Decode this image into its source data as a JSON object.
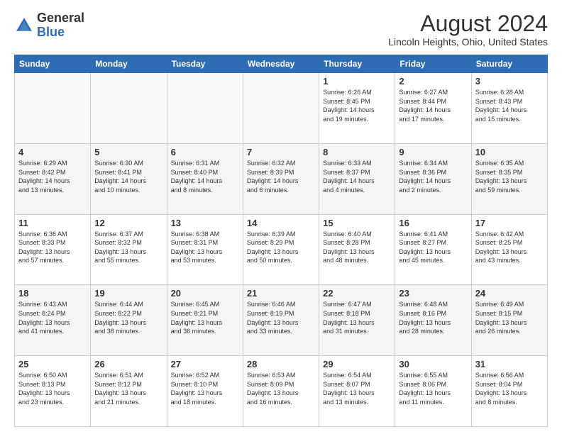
{
  "header": {
    "logo_general": "General",
    "logo_blue": "Blue",
    "title": "August 2024",
    "location": "Lincoln Heights, Ohio, United States"
  },
  "weekdays": [
    "Sunday",
    "Monday",
    "Tuesday",
    "Wednesday",
    "Thursday",
    "Friday",
    "Saturday"
  ],
  "weeks": [
    [
      {
        "day": "",
        "detail": ""
      },
      {
        "day": "",
        "detail": ""
      },
      {
        "day": "",
        "detail": ""
      },
      {
        "day": "",
        "detail": ""
      },
      {
        "day": "1",
        "detail": "Sunrise: 6:26 AM\nSunset: 8:45 PM\nDaylight: 14 hours\nand 19 minutes."
      },
      {
        "day": "2",
        "detail": "Sunrise: 6:27 AM\nSunset: 8:44 PM\nDaylight: 14 hours\nand 17 minutes."
      },
      {
        "day": "3",
        "detail": "Sunrise: 6:28 AM\nSunset: 8:43 PM\nDaylight: 14 hours\nand 15 minutes."
      }
    ],
    [
      {
        "day": "4",
        "detail": "Sunrise: 6:29 AM\nSunset: 8:42 PM\nDaylight: 14 hours\nand 13 minutes."
      },
      {
        "day": "5",
        "detail": "Sunrise: 6:30 AM\nSunset: 8:41 PM\nDaylight: 14 hours\nand 10 minutes."
      },
      {
        "day": "6",
        "detail": "Sunrise: 6:31 AM\nSunset: 8:40 PM\nDaylight: 14 hours\nand 8 minutes."
      },
      {
        "day": "7",
        "detail": "Sunrise: 6:32 AM\nSunset: 8:39 PM\nDaylight: 14 hours\nand 6 minutes."
      },
      {
        "day": "8",
        "detail": "Sunrise: 6:33 AM\nSunset: 8:37 PM\nDaylight: 14 hours\nand 4 minutes."
      },
      {
        "day": "9",
        "detail": "Sunrise: 6:34 AM\nSunset: 8:36 PM\nDaylight: 14 hours\nand 2 minutes."
      },
      {
        "day": "10",
        "detail": "Sunrise: 6:35 AM\nSunset: 8:35 PM\nDaylight: 13 hours\nand 59 minutes."
      }
    ],
    [
      {
        "day": "11",
        "detail": "Sunrise: 6:36 AM\nSunset: 8:33 PM\nDaylight: 13 hours\nand 57 minutes."
      },
      {
        "day": "12",
        "detail": "Sunrise: 6:37 AM\nSunset: 8:32 PM\nDaylight: 13 hours\nand 55 minutes."
      },
      {
        "day": "13",
        "detail": "Sunrise: 6:38 AM\nSunset: 8:31 PM\nDaylight: 13 hours\nand 53 minutes."
      },
      {
        "day": "14",
        "detail": "Sunrise: 6:39 AM\nSunset: 8:29 PM\nDaylight: 13 hours\nand 50 minutes."
      },
      {
        "day": "15",
        "detail": "Sunrise: 6:40 AM\nSunset: 8:28 PM\nDaylight: 13 hours\nand 48 minutes."
      },
      {
        "day": "16",
        "detail": "Sunrise: 6:41 AM\nSunset: 8:27 PM\nDaylight: 13 hours\nand 45 minutes."
      },
      {
        "day": "17",
        "detail": "Sunrise: 6:42 AM\nSunset: 8:25 PM\nDaylight: 13 hours\nand 43 minutes."
      }
    ],
    [
      {
        "day": "18",
        "detail": "Sunrise: 6:43 AM\nSunset: 8:24 PM\nDaylight: 13 hours\nand 41 minutes."
      },
      {
        "day": "19",
        "detail": "Sunrise: 6:44 AM\nSunset: 8:22 PM\nDaylight: 13 hours\nand 38 minutes."
      },
      {
        "day": "20",
        "detail": "Sunrise: 6:45 AM\nSunset: 8:21 PM\nDaylight: 13 hours\nand 36 minutes."
      },
      {
        "day": "21",
        "detail": "Sunrise: 6:46 AM\nSunset: 8:19 PM\nDaylight: 13 hours\nand 33 minutes."
      },
      {
        "day": "22",
        "detail": "Sunrise: 6:47 AM\nSunset: 8:18 PM\nDaylight: 13 hours\nand 31 minutes."
      },
      {
        "day": "23",
        "detail": "Sunrise: 6:48 AM\nSunset: 8:16 PM\nDaylight: 13 hours\nand 28 minutes."
      },
      {
        "day": "24",
        "detail": "Sunrise: 6:49 AM\nSunset: 8:15 PM\nDaylight: 13 hours\nand 26 minutes."
      }
    ],
    [
      {
        "day": "25",
        "detail": "Sunrise: 6:50 AM\nSunset: 8:13 PM\nDaylight: 13 hours\nand 23 minutes."
      },
      {
        "day": "26",
        "detail": "Sunrise: 6:51 AM\nSunset: 8:12 PM\nDaylight: 13 hours\nand 21 minutes."
      },
      {
        "day": "27",
        "detail": "Sunrise: 6:52 AM\nSunset: 8:10 PM\nDaylight: 13 hours\nand 18 minutes."
      },
      {
        "day": "28",
        "detail": "Sunrise: 6:53 AM\nSunset: 8:09 PM\nDaylight: 13 hours\nand 16 minutes."
      },
      {
        "day": "29",
        "detail": "Sunrise: 6:54 AM\nSunset: 8:07 PM\nDaylight: 13 hours\nand 13 minutes."
      },
      {
        "day": "30",
        "detail": "Sunrise: 6:55 AM\nSunset: 8:06 PM\nDaylight: 13 hours\nand 11 minutes."
      },
      {
        "day": "31",
        "detail": "Sunrise: 6:56 AM\nSunset: 8:04 PM\nDaylight: 13 hours\nand 8 minutes."
      }
    ]
  ]
}
